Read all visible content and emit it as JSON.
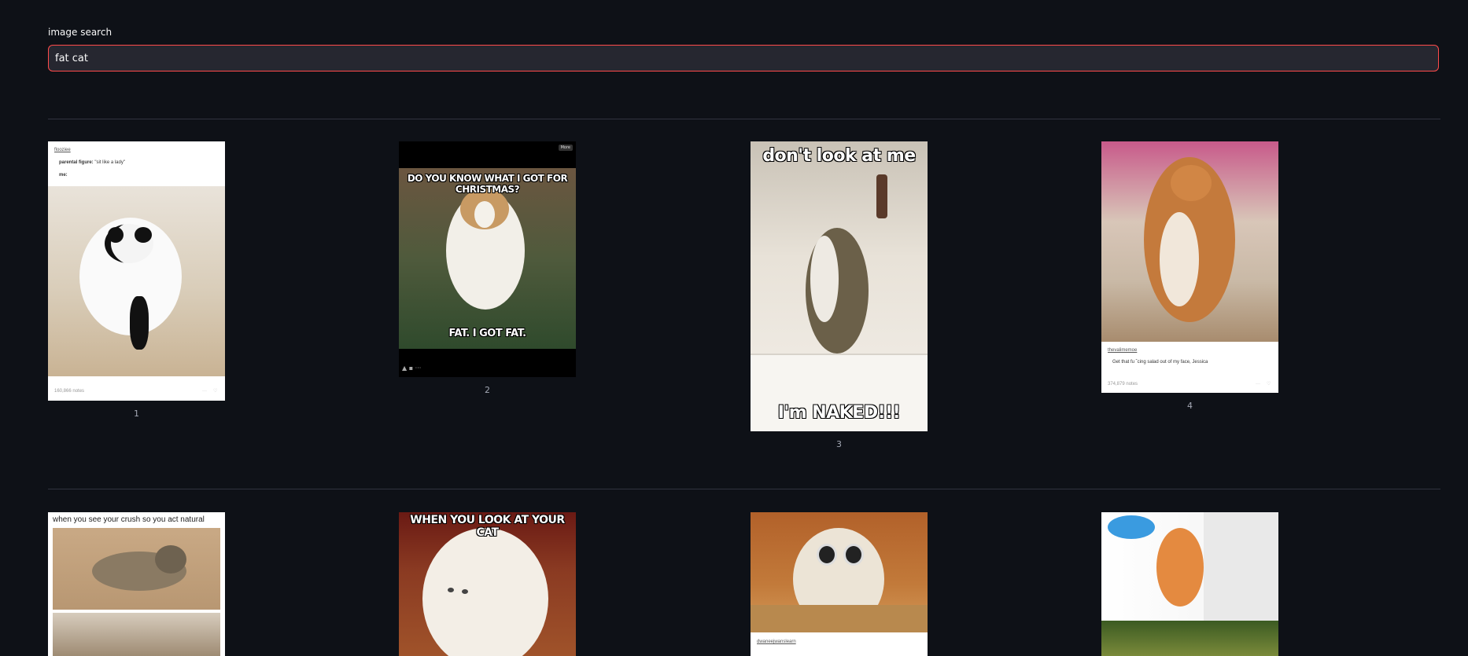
{
  "search": {
    "label": "image search",
    "value": "fat cat"
  },
  "row1": [
    {
      "caption": "1",
      "source": "flooziee",
      "line1_label": "parental figure:",
      "line1_text": "\"sit like a lady\"",
      "line2_label": "me:",
      "notes": "160,866 notes"
    },
    {
      "caption": "2",
      "top_text": "DO YOU KNOW WHAT I GOT FOR CHRISTMAS?",
      "bottom_text": "FAT.   I GOT FAT.",
      "more_label": "More"
    },
    {
      "caption": "3",
      "top_text": "don't look at me",
      "bottom_text": "I'm NAKED!!!"
    },
    {
      "caption": "4",
      "source": "thevalimemoe",
      "quote": "Get that fu ˆcing salad out of my face, Jessica",
      "notes": "374,879 notes"
    }
  ],
  "row2": [
    {
      "top_text": "when you see your crush so you act natural"
    },
    {
      "top_text": "WHEN YOU LOOK AT YOUR CAT"
    },
    {
      "source": "dwaneejwanslearn"
    },
    {}
  ]
}
